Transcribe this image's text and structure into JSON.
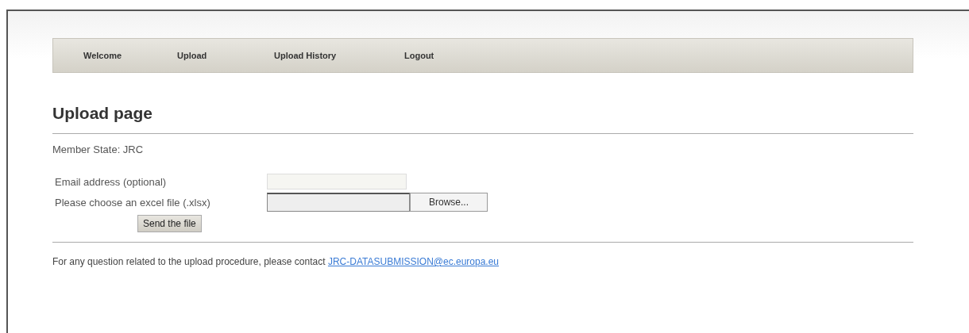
{
  "nav": [
    {
      "label": "Welcome"
    },
    {
      "label": "Upload"
    },
    {
      "label": "Upload History"
    },
    {
      "label": "Logout"
    }
  ],
  "heading": "Upload page",
  "member_state": "Member State: JRC",
  "form": {
    "email_label": "Email address (optional)",
    "file_label": "Please choose an excel file (.xlsx)",
    "browse_button": "Browse...",
    "send_button": "Send the file"
  },
  "footer": {
    "text": "For any question related to the upload procedure, please contact",
    "link": "JRC-DATASUBMISSION@ec.europa.eu"
  }
}
